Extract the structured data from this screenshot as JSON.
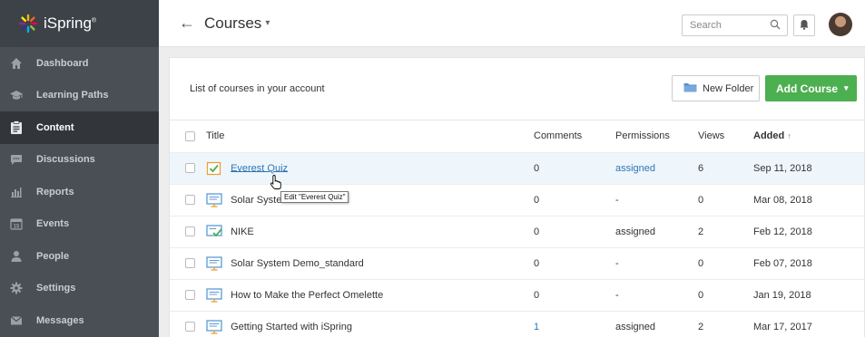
{
  "brand": {
    "name": "iSpring",
    "trademark": "®",
    "icon": "ispring-logo-icon"
  },
  "sidebar": {
    "items": [
      {
        "label": "Dashboard",
        "icon": "home-icon",
        "active": false
      },
      {
        "label": "Learning Paths",
        "icon": "graduation-cap-icon",
        "active": false
      },
      {
        "label": "Content",
        "icon": "clipboard-icon",
        "active": true
      },
      {
        "label": "Discussions",
        "icon": "chat-bubble-icon",
        "active": false
      },
      {
        "label": "Reports",
        "icon": "bar-chart-icon",
        "active": false
      },
      {
        "label": "Events",
        "icon": "calendar-icon",
        "active": false
      },
      {
        "label": "People",
        "icon": "person-icon",
        "active": false
      },
      {
        "label": "Settings",
        "icon": "gear-icon",
        "active": false
      },
      {
        "label": "Messages",
        "icon": "envelope-icon",
        "active": false
      }
    ]
  },
  "header": {
    "title": "Courses",
    "back_icon": "←",
    "title_caret": "▾",
    "search": {
      "placeholder": "Search",
      "value": ""
    }
  },
  "panel": {
    "subtitle": "List of courses in your account",
    "new_folder_label": "New Folder",
    "add_course_label": "Add Course",
    "add_course_caret": "▾"
  },
  "table": {
    "columns": {
      "title": "Title",
      "comments": "Comments",
      "permissions": "Permissions",
      "views": "Views",
      "added": "Added",
      "added_sort": "↑"
    },
    "rows": [
      {
        "title": "Everest Quiz",
        "type": "quiz",
        "comments": "0",
        "permissions": "assigned",
        "views": "6",
        "added": "Sep 11, 2018",
        "linked": true,
        "highlight": true
      },
      {
        "title": "Solar System Demo",
        "type": "presentation",
        "comments": "0",
        "permissions": "-",
        "views": "0",
        "added": "Mar 08, 2018",
        "linked": false,
        "highlight": false
      },
      {
        "title": "NIKE",
        "type": "presentation-quiz",
        "comments": "0",
        "permissions": "assigned",
        "views": "2",
        "added": "Feb 12, 2018",
        "linked": false,
        "highlight": false
      },
      {
        "title": "Solar System Demo_standard",
        "type": "presentation",
        "comments": "0",
        "permissions": "-",
        "views": "0",
        "added": "Feb 07, 2018",
        "linked": false,
        "highlight": false
      },
      {
        "title": "How to Make the Perfect Omelette",
        "type": "presentation",
        "comments": "0",
        "permissions": "-",
        "views": "0",
        "added": "Jan 19, 2018",
        "linked": false,
        "highlight": false
      },
      {
        "title": "Getting Started with iSpring",
        "type": "presentation",
        "comments": "1",
        "permissions": "assigned",
        "views": "2",
        "added": "Mar 17, 2017",
        "linked": false,
        "highlight": false
      }
    ]
  },
  "tooltip": {
    "text": "Edit \"Everest Quiz\""
  },
  "colors": {
    "sidebar_bg": "#4a4f55",
    "accent_green": "#4caf50",
    "link_blue": "#2f75b5"
  }
}
